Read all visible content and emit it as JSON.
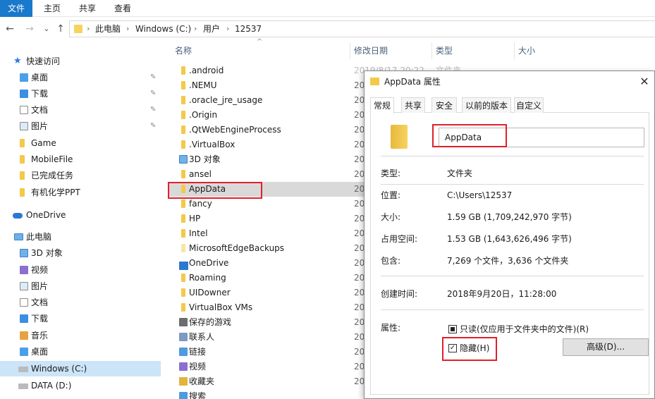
{
  "ribbon": {
    "tabs": [
      "文件",
      "主页",
      "共享",
      "查看"
    ]
  },
  "nav": {
    "back": "←",
    "forward": "→",
    "recent": "⌄",
    "up": "↑",
    "breadcrumbs": [
      "此电脑",
      "Windows (C:)",
      "用户",
      "12537"
    ],
    "separator": "›"
  },
  "sidebar": {
    "quick_access": "快速访问",
    "items": [
      {
        "label": "桌面",
        "pinned": true
      },
      {
        "label": "下载",
        "pinned": true
      },
      {
        "label": "文档",
        "pinned": true
      },
      {
        "label": "图片",
        "pinned": true
      },
      {
        "label": "Game"
      },
      {
        "label": "MobileFile"
      },
      {
        "label": "已完成任务"
      },
      {
        "label": "有机化学PPT"
      }
    ],
    "onedrive": "OneDrive",
    "this_pc": "此电脑",
    "pc_items": [
      "3D 对象",
      "视频",
      "图片",
      "文档",
      "下载",
      "音乐",
      "桌面",
      "Windows (C:)",
      "DATA (D:)"
    ],
    "pin_glyph": "📌"
  },
  "filelist": {
    "columns": [
      "名称",
      "修改日期",
      "类型",
      "大小"
    ],
    "sort_glyph": "^",
    "first_date": "2019/8/17 20:22",
    "first_type": "文件夹",
    "date_prefix": "20",
    "rows": [
      ".android",
      ".NEMU",
      ".oracle_jre_usage",
      ".Origin",
      ".QtWebEngineProcess",
      ".VirtualBox",
      "3D 对象",
      "ansel",
      "AppData",
      "fancy",
      "HP",
      "Intel",
      "MicrosoftEdgeBackups",
      "OneDrive",
      "Roaming",
      "UIDowner",
      "VirtualBox VMs",
      "保存的游戏",
      "联系人",
      "链接",
      "视频",
      "收藏夹",
      "搜索"
    ]
  },
  "dialog": {
    "title": "AppData 属性",
    "close": "✕",
    "tabs": [
      "常规",
      "共享",
      "安全",
      "以前的版本",
      "自定义"
    ],
    "name": "AppData",
    "type_label": "类型:",
    "type_value": "文件夹",
    "location_label": "位置:",
    "location_value": "C:\\Users\\12537",
    "size_label": "大小:",
    "size_value": "1.59 GB (1,709,242,970 字节)",
    "disk_label": "占用空间:",
    "disk_value": "1.53 GB (1,643,626,496 字节)",
    "contains_label": "包含:",
    "contains_value": "7,269 个文件，3,636 个文件夹",
    "created_label": "创建时间:",
    "created_value": "2018年9月20日，11:28:00",
    "attributes_label": "属性:",
    "readonly_label": "只读(仅应用于文件夹中的文件)(R)",
    "hidden_label": "隐藏(H)",
    "hidden_checked": "✓",
    "advanced_button": "高级(D)..."
  },
  "colors": {
    "accent": "#1979ca",
    "highlight_red": "#e0202a",
    "selected_nav": "#cce4f7",
    "folder": "#f3c94a"
  }
}
